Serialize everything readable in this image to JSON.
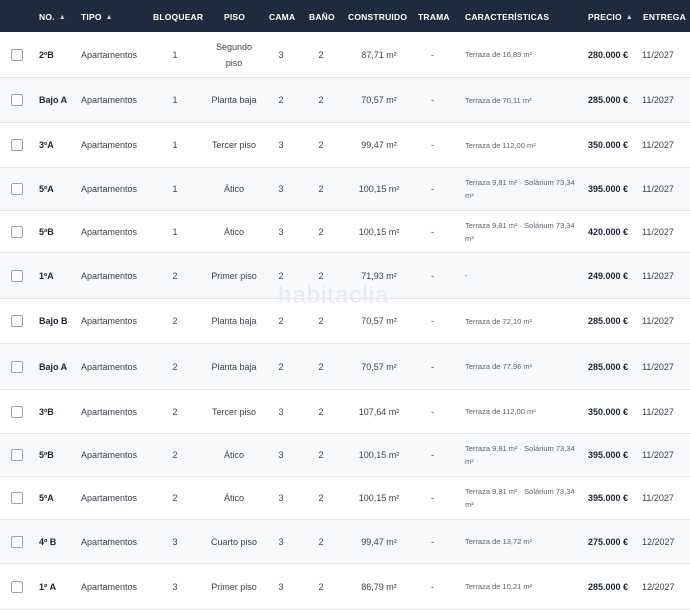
{
  "table": {
    "headers": {
      "no": "NO.",
      "tipo": "TIPO",
      "bloquear": "BLOQUEAR",
      "piso": "PISO",
      "cama": "CAMA",
      "bano": "BAÑO",
      "construido": "CONSTRUIDO",
      "trama": "TRAMA",
      "caracteristicas": "CARACTERÍSTICAS",
      "precio": "PRECIO",
      "entrega": "ENTREGA"
    },
    "sort_icon": "▲",
    "rows": [
      {
        "no": "2ºB",
        "tipo": "Apartamentos",
        "bloquear": "1",
        "piso": "Segundo piso",
        "cama": "3",
        "bano": "2",
        "construido": "87,71 m²",
        "trama": "-",
        "caracteristicas": "Terraza de 16,89 m²",
        "precio": "280.000 €",
        "entrega": "11/2027"
      },
      {
        "no": "Bajo A",
        "tipo": "Apartamentos",
        "bloquear": "1",
        "piso": "Planta baja",
        "cama": "2",
        "bano": "2",
        "construido": "70,57 m²",
        "trama": "-",
        "caracteristicas": "Terraza de 70,11 m²",
        "precio": "285.000 €",
        "entrega": "11/2027"
      },
      {
        "no": "3ºA",
        "tipo": "Apartamentos",
        "bloquear": "1",
        "piso": "Tercer piso",
        "cama": "3",
        "bano": "2",
        "construido": "99,47 m²",
        "trama": "-",
        "caracteristicas": "Terraza de 112,00 m²",
        "precio": "350.000 €",
        "entrega": "11/2027"
      },
      {
        "no": "5ºA",
        "tipo": "Apartamentos",
        "bloquear": "1",
        "piso": "Ático",
        "cama": "3",
        "bano": "2",
        "construido": "100,15 m²",
        "trama": "-",
        "caracteristicas": "Terraza 9,81 m² · Solárium 73,34 m²",
        "precio": "395.000 €",
        "entrega": "11/2027"
      },
      {
        "no": "5ºB",
        "tipo": "Apartamentos",
        "bloquear": "1",
        "piso": "Ático",
        "cama": "3",
        "bano": "2",
        "construido": "100,15 m²",
        "trama": "-",
        "caracteristicas": "Terraza 9,81 m² · Solárium 73,34 m²",
        "precio": "420.000 €",
        "entrega": "11/2027"
      },
      {
        "no": "1ºA",
        "tipo": "Apartamentos",
        "bloquear": "2",
        "piso": "Primer piso",
        "cama": "2",
        "bano": "2",
        "construido": "71,93 m²",
        "trama": "-",
        "caracteristicas": "-",
        "precio": "249.000 €",
        "entrega": "11/2027"
      },
      {
        "no": "Bajo B",
        "tipo": "Apartamentos",
        "bloquear": "2",
        "piso": "Planta baja",
        "cama": "2",
        "bano": "2",
        "construido": "70,57 m²",
        "trama": "-",
        "caracteristicas": "Terraza de 72,10 m²",
        "precio": "285.000 €",
        "entrega": "11/2027"
      },
      {
        "no": "Bajo A",
        "tipo": "Apartamentos",
        "bloquear": "2",
        "piso": "Planta baja",
        "cama": "2",
        "bano": "2",
        "construido": "70,57 m²",
        "trama": "-",
        "caracteristicas": "Terraza de 77,96 m²",
        "precio": "285.000 €",
        "entrega": "11/2027"
      },
      {
        "no": "3ºB",
        "tipo": "Apartamentos",
        "bloquear": "2",
        "piso": "Tercer piso",
        "cama": "3",
        "bano": "2",
        "construido": "107,64 m²",
        "trama": "-",
        "caracteristicas": "Terraza de 112,00 m²",
        "precio": "350.000 €",
        "entrega": "11/2027"
      },
      {
        "no": "5ºB",
        "tipo": "Apartamentos",
        "bloquear": "2",
        "piso": "Ático",
        "cama": "3",
        "bano": "2",
        "construido": "100,15 m²",
        "trama": "-",
        "caracteristicas": "Terraza 9,81 m² · Solárium 73,34 m²",
        "precio": "395.000 €",
        "entrega": "11/2027"
      },
      {
        "no": "5ºA",
        "tipo": "Apartamentos",
        "bloquear": "2",
        "piso": "Ático",
        "cama": "3",
        "bano": "2",
        "construido": "100,15 m²",
        "trama": "-",
        "caracteristicas": "Terraza 9,81 m² · Solárium 73,34 m²",
        "precio": "395.000 €",
        "entrega": "11/2027"
      },
      {
        "no": "4º B",
        "tipo": "Apartamentos",
        "bloquear": "3",
        "piso": "Cuarto piso",
        "cama": "3",
        "bano": "2",
        "construido": "99,47 m²",
        "trama": "-",
        "caracteristicas": "Terraza de 13,72 m²",
        "precio": "275.000 €",
        "entrega": "12/2027"
      },
      {
        "no": "1º A",
        "tipo": "Apartamentos",
        "bloquear": "3",
        "piso": "Primer piso",
        "cama": "3",
        "bano": "2",
        "construido": "86,79 m²",
        "trama": "-",
        "caracteristicas": "Terraza de 10,21 m²",
        "precio": "285.000 €",
        "entrega": "12/2027"
      }
    ]
  },
  "watermark": "habitaclia"
}
